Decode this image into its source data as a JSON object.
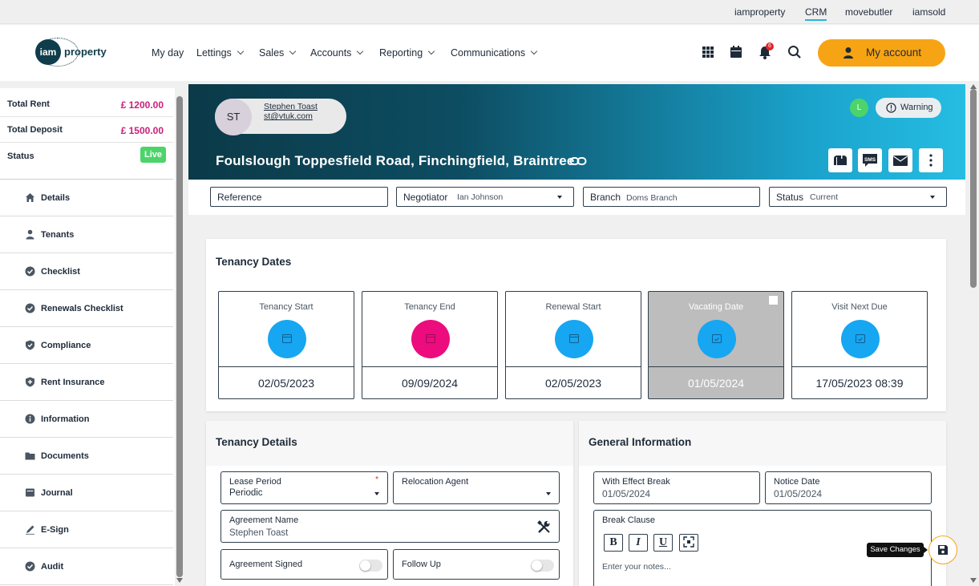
{
  "top_links": [
    "iamproperty",
    "CRM",
    "movebutler",
    "iamsold"
  ],
  "logo": {
    "mark": "iam",
    "word": "property"
  },
  "nav": [
    "My day",
    "Lettings",
    "Sales",
    "Accounts",
    "Reporting",
    "Communications"
  ],
  "notification_count": "6",
  "my_account": "My account",
  "summary": {
    "total_rent_label": "Total Rent",
    "total_rent": "£ 1200.00",
    "total_deposit_label": "Total Deposit",
    "total_deposit": "£ 1500.00",
    "status_label": "Status",
    "status": "Live"
  },
  "sidebar": [
    "Details",
    "Tenants",
    "Checklist",
    "Renewals Checklist",
    "Compliance",
    "Rent Insurance",
    "Information",
    "Documents",
    "Journal",
    "E-Sign",
    "Audit"
  ],
  "contact": {
    "initials": "ST",
    "name": "Stephen Toast",
    "email": "st@vtuk.com"
  },
  "address": "Foulslough Toppesfield Road, Finchingfield, Braintree",
  "user_badge": "L",
  "warning": "Warning",
  "action_sms": "SMS",
  "fields": {
    "reference_label": "Reference",
    "reference_value": "",
    "negotiator_label": "Negotiator",
    "negotiator_value": "Ian Johnson",
    "branch_label": "Branch",
    "branch_value": "Doms Branch",
    "status_label": "Status",
    "status_value": "Current"
  },
  "tenancy_dates": {
    "title": "Tenancy Dates",
    "items": [
      {
        "label": "Tenancy Start",
        "value": "02/05/2023",
        "color": "#17a6f2"
      },
      {
        "label": "Tenancy End",
        "value": "09/09/2024",
        "color": "#ec0c7e"
      },
      {
        "label": "Renewal Start",
        "value": "02/05/2023",
        "color": "#17a6f2"
      },
      {
        "label": "Vacating Date",
        "value": "01/05/2024",
        "color": "#17a6f2"
      },
      {
        "label": "Visit Next Due",
        "value": "17/05/2023 08:39",
        "color": "#17a6f2"
      }
    ]
  },
  "tenancy_details": {
    "title": "Tenancy Details",
    "lease_period_label": "Lease Period",
    "lease_period": "Periodic",
    "lease_required": "*",
    "relocation_agent_label": "Relocation Agent",
    "relocation_agent": "",
    "agreement_name_label": "Agreement Name",
    "agreement_name": "Stephen  Toast",
    "agreement_signed_label": "Agreement Signed",
    "follow_up_label": "Follow Up"
  },
  "general_info": {
    "title": "General Information",
    "with_effect_break_label": "With Effect Break",
    "with_effect_break": "01/05/2024",
    "notice_date_label": "Notice Date",
    "notice_date": "01/05/2024",
    "break_clause_label": "Break Clause",
    "format_buttons": [
      "B",
      "I",
      "U"
    ],
    "notes_placeholder": "Enter your notes..."
  },
  "save_tooltip": "Save Changes",
  "colors": {
    "accent": "#f7a414",
    "brand_dark": "#0b3a48",
    "brand_light": "#26bde3",
    "live": "#4cd46a",
    "money": "#c8207a"
  }
}
